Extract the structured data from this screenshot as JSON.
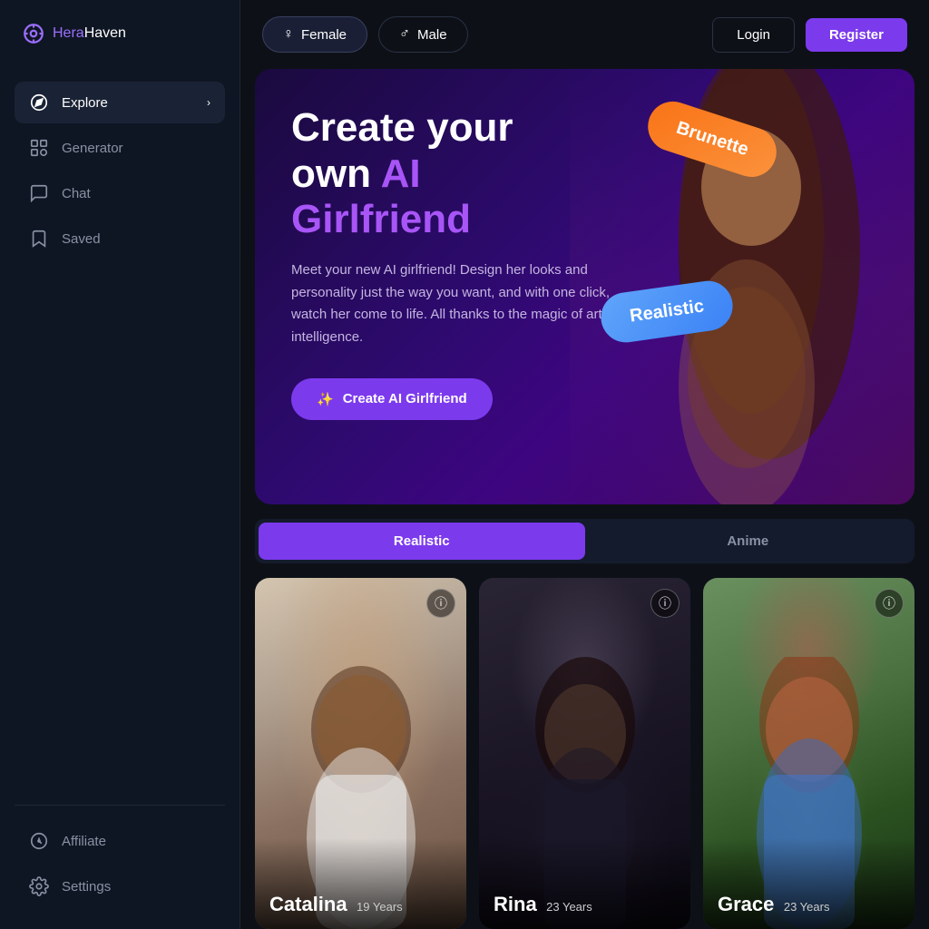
{
  "logo": {
    "hera": "Hera",
    "haven": "Haven"
  },
  "sidebar": {
    "nav": [
      {
        "id": "explore",
        "label": "Explore",
        "icon": "compass",
        "active": true,
        "hasChevron": true
      },
      {
        "id": "generator",
        "label": "Generator",
        "icon": "generator",
        "active": false,
        "hasChevron": false
      },
      {
        "id": "chat",
        "label": "Chat",
        "icon": "chat",
        "active": false,
        "hasChevron": false
      },
      {
        "id": "saved",
        "label": "Saved",
        "icon": "saved",
        "active": false,
        "hasChevron": false
      }
    ],
    "bottom": [
      {
        "id": "affiliate",
        "label": "Affiliate",
        "icon": "affiliate"
      },
      {
        "id": "settings",
        "label": "Settings",
        "icon": "settings"
      }
    ]
  },
  "topbar": {
    "female_label": "Female",
    "male_label": "Male",
    "login_label": "Login",
    "register_label": "Register"
  },
  "hero": {
    "title_line1": "Create your",
    "title_line2": "own ",
    "title_accent": "AI",
    "title_line3": "Girlfriend",
    "description": "Meet your new AI girlfriend! Design her looks and personality just the way you want, and with one click, watch her come to life. All thanks to the magic of artificial intelligence.",
    "cta_label": "Create AI Girlfriend",
    "pill1": "Brunette",
    "pill2": "Realistic"
  },
  "tabs": [
    {
      "id": "realistic",
      "label": "Realistic",
      "active": true
    },
    {
      "id": "anime",
      "label": "Anime",
      "active": false
    }
  ],
  "cards": [
    {
      "id": "catalina",
      "name": "Catalina",
      "age": "19 Years",
      "style": "catalina"
    },
    {
      "id": "rina",
      "name": "Rina",
      "age": "23 Years",
      "style": "rina"
    },
    {
      "id": "grace",
      "name": "Grace",
      "age": "23 Years",
      "style": "grace"
    }
  ]
}
